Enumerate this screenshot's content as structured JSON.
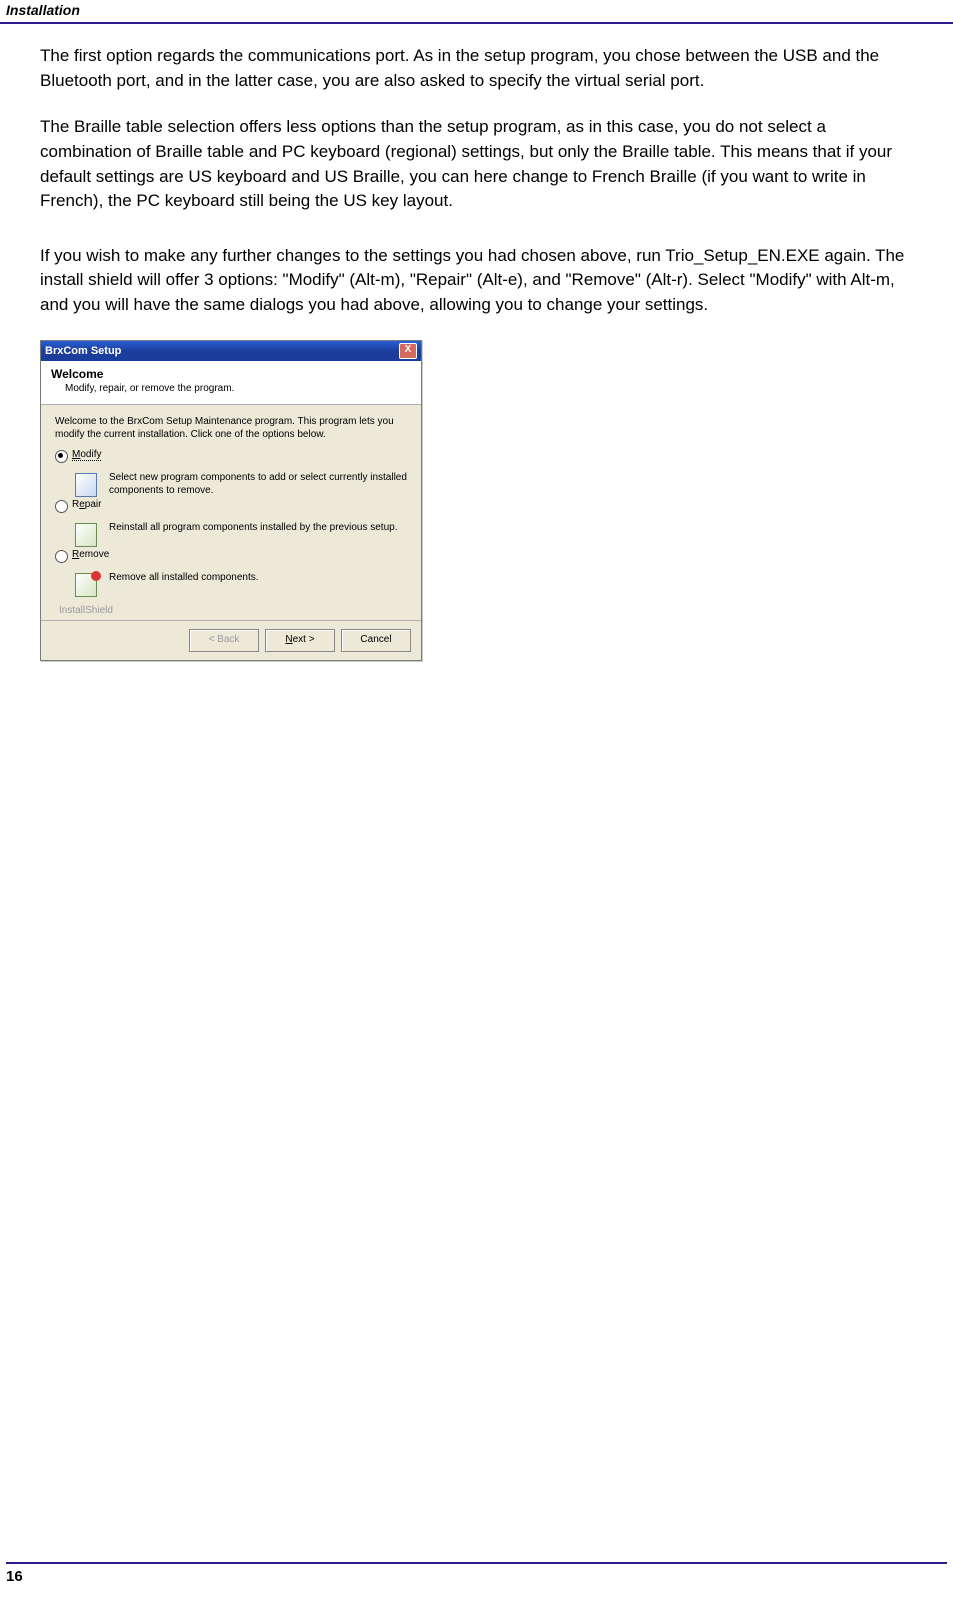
{
  "header": {
    "title": "Installation"
  },
  "paragraphs": {
    "p1": "The first option regards the communications port. As in the setup program, you chose between the USB and the Bluetooth port, and in the latter case, you are also asked to specify the virtual serial port.",
    "p2": "The Braille table selection offers less options than the setup program, as in this case, you do not select a combination of Braille table and PC keyboard (regional) settings, but only the Braille table. This means that if your default settings are US keyboard and US Braille, you can here change to French Braille (if you want to write in French), the PC keyboard still being the US key layout.",
    "p3": "If you wish to make any further changes to the settings you had chosen above, run Trio_Setup_EN.EXE again. The install shield will offer 3 options: \"Modify\" (Alt-m), \"Repair\" (Alt-e), and \"Remove\" (Alt-r). Select \"Modify\" with Alt-m, and you will have the same dialogs you had above, allowing you to change your settings."
  },
  "dialog": {
    "title": "BrxCom Setup",
    "close": "X",
    "welcome_title": "Welcome",
    "welcome_sub": "Modify, repair, or remove the program.",
    "intro": "Welcome to the BrxCom Setup Maintenance program. This program lets you modify the current installation. Click one of the options below.",
    "options": [
      {
        "label_pre": "",
        "label_ul": "M",
        "label_post": "odify",
        "desc": "Select new program components to add or select currently installed components to remove.",
        "checked": true,
        "kind": "modify"
      },
      {
        "label_pre": "R",
        "label_ul": "e",
        "label_post": "pair",
        "desc": "Reinstall all program components installed by the previous setup.",
        "checked": false,
        "kind": "repair"
      },
      {
        "label_pre": "",
        "label_ul": "R",
        "label_post": "emove",
        "desc": "Remove all installed components.",
        "checked": false,
        "kind": "remove"
      }
    ],
    "shield": "InstallShield",
    "buttons": {
      "back": "< Back",
      "next_ul": "N",
      "next_rest": "ext >",
      "cancel": "Cancel"
    }
  },
  "footer": {
    "page": "16"
  }
}
